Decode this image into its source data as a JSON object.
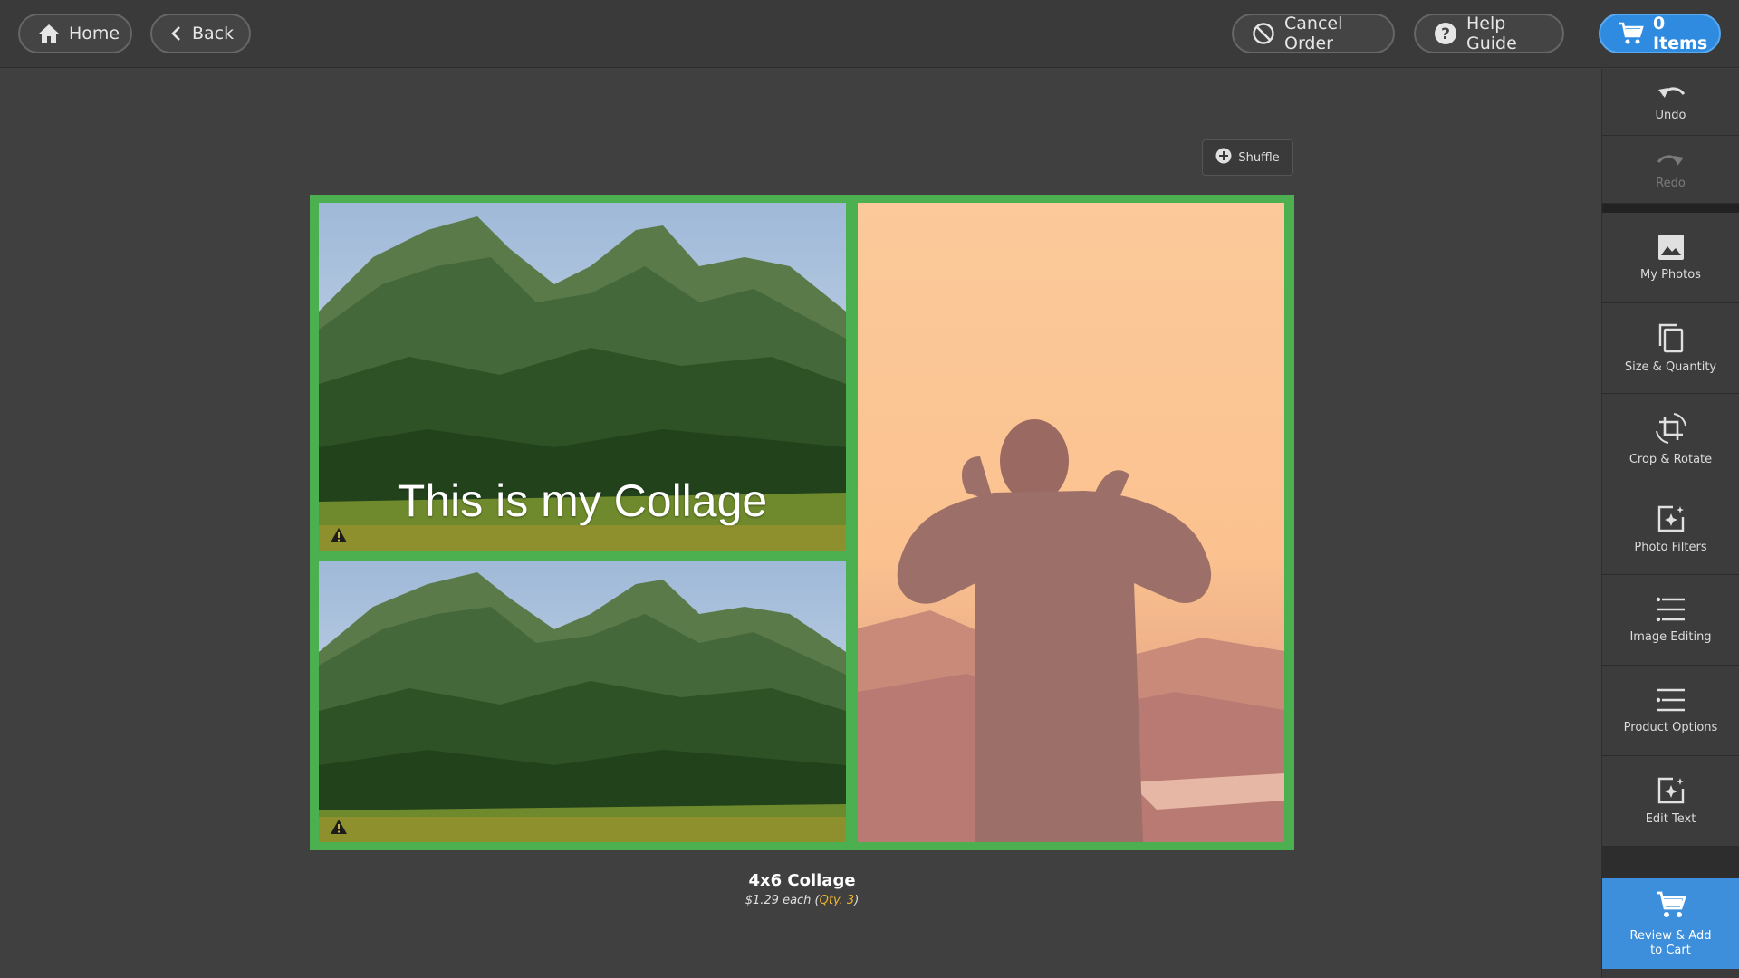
{
  "header": {
    "home_label": "Home",
    "back_label": "Back",
    "cancel_label": "Cancel Order",
    "help_label": "Help Guide",
    "cart_label": "0 Items"
  },
  "tools": {
    "undo": "Undo",
    "redo": "Redo",
    "my_photos": "My Photos",
    "size_quantity": "Size & Quantity",
    "crop_rotate": "Crop & Rotate",
    "photo_filters": "Photo Filters",
    "image_editing": "Image Editing",
    "product_options": "Product Options",
    "edit_text": "Edit Text",
    "review_cart_line1": "Review & Add",
    "review_cart_line2": "to Cart"
  },
  "canvas": {
    "shuffle_label": "Shuffle",
    "collage_text": "This is my Collage"
  },
  "product": {
    "title": "4x6 Collage",
    "price_text": "$1.29 each (",
    "qty_text": "Qty. 3",
    "price_close": ")"
  },
  "colors": {
    "accent": "#2f8be0",
    "collage_border": "#4caf50",
    "qty_highlight": "#f0b429"
  }
}
